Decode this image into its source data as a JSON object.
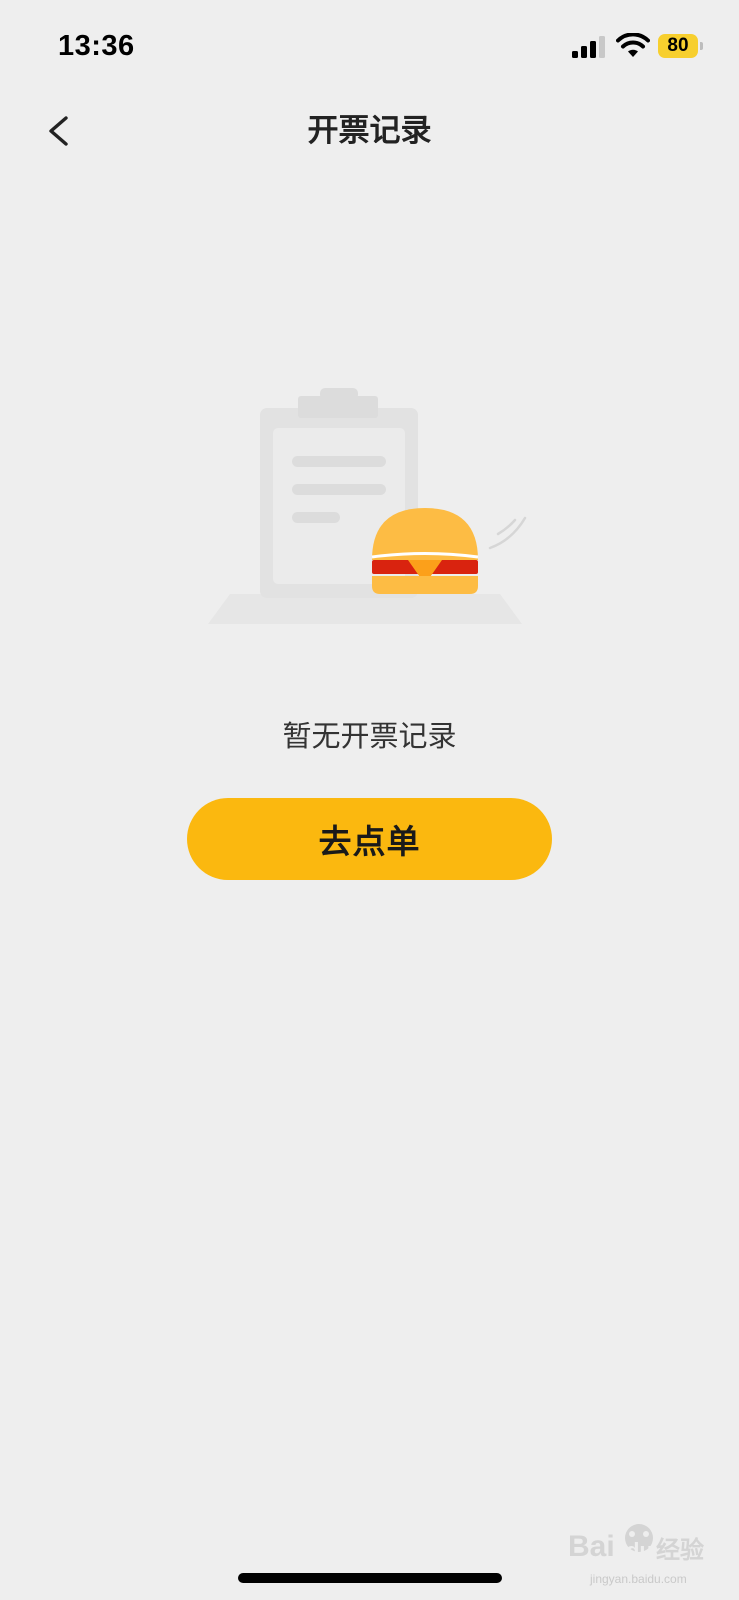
{
  "status_bar": {
    "time": "13:36",
    "battery_level": "80",
    "signal_icon": "cellular-signal-icon",
    "wifi_icon": "wifi-icon",
    "battery_color": "#f7cf2e"
  },
  "nav": {
    "title": "开票记录",
    "back_icon": "chevron-left-icon"
  },
  "empty_state": {
    "illustration_icon": "clipboard-with-burger-icon",
    "message": "暂无开票记录"
  },
  "primary_action": {
    "label": "去点单",
    "color": "#fbb80f"
  },
  "watermark": {
    "logo_text": "Baidu经验",
    "sub_text": "jingyan.baidu.com"
  }
}
